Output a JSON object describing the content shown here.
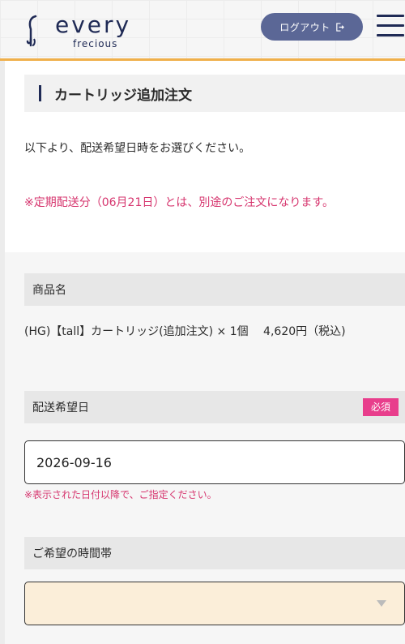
{
  "header": {
    "logo_main": "every",
    "logo_sub": "frecious",
    "logout_label": "ログアウト"
  },
  "page": {
    "title": "カートリッジ追加注文",
    "intro": "以下より、配送希望日時をお選びください。",
    "notice": "※定期配送分（06月21日）とは、別途のご注文になります。"
  },
  "product": {
    "section_label": "商品名",
    "description": "(HG)【tall】カートリッジ(追加注文) × 1個　 4,620円（税込)"
  },
  "delivery_date": {
    "section_label": "配送希望日",
    "required_badge": "必須",
    "value": "2026-09-16",
    "note": "※表示された日付以降で、ご指定ください。"
  },
  "time_slot": {
    "section_label": "ご希望の時間帯",
    "value": ""
  },
  "colors": {
    "brand_navy": "#1f2a55",
    "logout_bg": "#5b6796",
    "accent_orange": "#f0b04b",
    "notice_pink": "#d6356e",
    "badge_pink": "#e83e8c",
    "select_bg": "#fbeed9"
  },
  "icons": {
    "logo": "water-drop-icon",
    "logout": "logout-arrow-icon",
    "menu": "hamburger-menu-icon",
    "select": "chevron-down-icon"
  }
}
